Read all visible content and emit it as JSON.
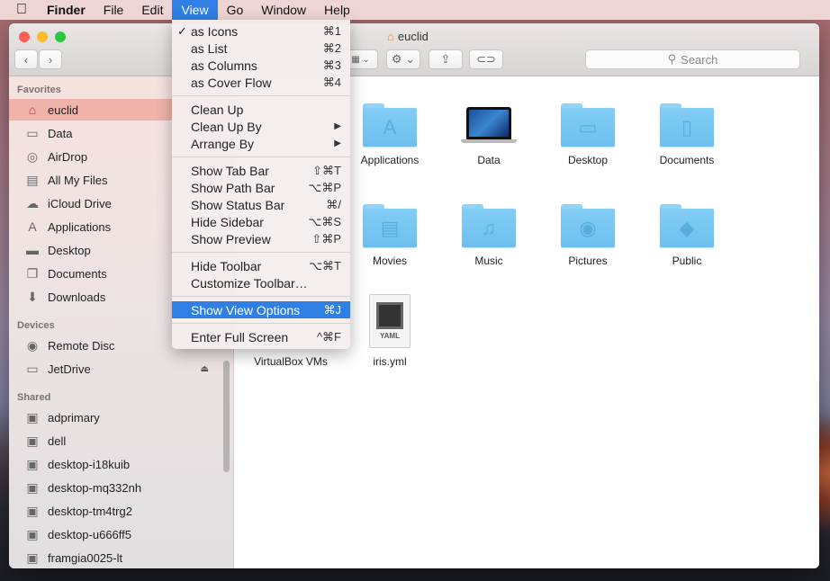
{
  "menubar": {
    "apple": "",
    "items": [
      "Finder",
      "File",
      "Edit",
      "View",
      "Go",
      "Window",
      "Help"
    ],
    "active": "View"
  },
  "window": {
    "title": "euclid",
    "search_placeholder": "Search"
  },
  "view_menu": {
    "groups": [
      [
        {
          "label": "as Icons",
          "shortcut": "⌘1",
          "checked": true
        },
        {
          "label": "as List",
          "shortcut": "⌘2"
        },
        {
          "label": "as Columns",
          "shortcut": "⌘3"
        },
        {
          "label": "as Cover Flow",
          "shortcut": "⌘4"
        }
      ],
      [
        {
          "label": "Clean Up",
          "shortcut": ""
        },
        {
          "label": "Clean Up By",
          "shortcut": "▶"
        },
        {
          "label": "Arrange By",
          "shortcut": "▶"
        }
      ],
      [
        {
          "label": "Show Tab Bar",
          "shortcut": "⇧⌘T"
        },
        {
          "label": "Show Path Bar",
          "shortcut": "⌥⌘P"
        },
        {
          "label": "Show Status Bar",
          "shortcut": "⌘/"
        },
        {
          "label": "Hide Sidebar",
          "shortcut": "⌥⌘S"
        },
        {
          "label": "Show Preview",
          "shortcut": "⇧⌘P"
        }
      ],
      [
        {
          "label": "Hide Toolbar",
          "shortcut": "⌥⌘T"
        },
        {
          "label": "Customize Toolbar…",
          "shortcut": ""
        }
      ],
      [
        {
          "label": "Show View Options",
          "shortcut": "⌘J",
          "highlighted": true
        }
      ],
      [
        {
          "label": "Enter Full Screen",
          "shortcut": "^⌘F"
        }
      ]
    ]
  },
  "sidebar": {
    "favorites_label": "Favorites",
    "favorites": [
      {
        "label": "euclid",
        "icon": "home-icon",
        "selected": true
      },
      {
        "label": "Data",
        "icon": "folder-icon"
      },
      {
        "label": "AirDrop",
        "icon": "airdrop-icon"
      },
      {
        "label": "All My Files",
        "icon": "all-files-icon"
      },
      {
        "label": "iCloud Drive",
        "icon": "cloud-icon"
      },
      {
        "label": "Applications",
        "icon": "applications-icon"
      },
      {
        "label": "Desktop",
        "icon": "desktop-icon"
      },
      {
        "label": "Documents",
        "icon": "documents-icon"
      },
      {
        "label": "Downloads",
        "icon": "downloads-icon"
      }
    ],
    "devices_label": "Devices",
    "devices": [
      {
        "label": "Remote Disc",
        "icon": "disc-icon"
      },
      {
        "label": "JetDrive",
        "icon": "drive-icon",
        "eject": true
      }
    ],
    "shared_label": "Shared",
    "shared": [
      {
        "label": "adprimary"
      },
      {
        "label": "dell"
      },
      {
        "label": "desktop-i18kuib"
      },
      {
        "label": "desktop-mq332nh"
      },
      {
        "label": "desktop-tm4trg2"
      },
      {
        "label": "desktop-u666ff5"
      },
      {
        "label": "framgia0025-lt"
      }
    ]
  },
  "files": [
    {
      "name": "Applications",
      "glyph": "A"
    },
    {
      "name": "Data",
      "glyph": "laptop"
    },
    {
      "name": "Desktop",
      "glyph": "▭"
    },
    {
      "name": "Documents",
      "glyph": "▯"
    },
    {
      "name": "Movies",
      "glyph": "▤"
    },
    {
      "name": "Music",
      "glyph": "♫"
    },
    {
      "name": "Pictures",
      "glyph": "◉"
    },
    {
      "name": "Public",
      "glyph": "◆"
    },
    {
      "name": "VirtualBox VMs",
      "glyph": ""
    },
    {
      "name": "iris.yml",
      "glyph": "YAML"
    }
  ]
}
